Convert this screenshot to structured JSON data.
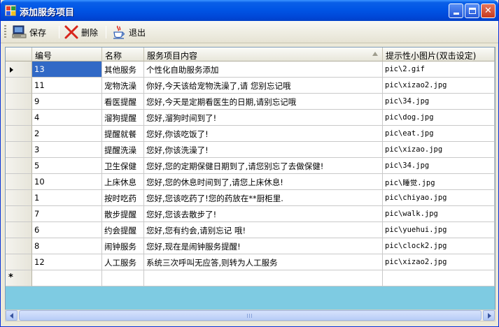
{
  "window": {
    "title": "添加服务项目"
  },
  "toolbar": {
    "save_label": "保存",
    "delete_label": "删除",
    "exit_label": "退出"
  },
  "grid": {
    "columns": [
      "编号",
      "名称",
      "服务项目内容",
      "提示性小图片(双击设定)"
    ],
    "rows": [
      [
        "13",
        "其他服务",
        "个性化自助服务添加",
        "pic\\2.gif"
      ],
      [
        "11",
        "宠物洗澡",
        "你好,今天该给宠物洗澡了,请  您别忘记哦",
        "pic\\xizao2.jpg"
      ],
      [
        "9",
        "看医提醒",
        "您好,今天是定期看医生的日期,请别忘记哦",
        "pic\\34.jpg"
      ],
      [
        "4",
        "溜狗提醒",
        "您好,溜狗时间到了!",
        "pic\\dog.jpg"
      ],
      [
        "2",
        "提醒就餐",
        "您好,你该吃饭了!",
        "pic\\eat.jpg"
      ],
      [
        "3",
        "提醒洗澡",
        "您好,你该洗澡了!",
        "pic\\xizao.jpg"
      ],
      [
        "5",
        "卫生保健",
        "您好,您的定期保健日期到了,请您别忘了去做保健!",
        "pic\\34.jpg"
      ],
      [
        "10",
        "上床休息",
        "您好,您的休息时间到了,请您上床休息!",
        "pic\\睡觉.jpg"
      ],
      [
        "1",
        "按时吃药",
        "您好,您该吃药了!您的药放在**厨柜里.",
        "pic\\chiyao.jpg"
      ],
      [
        "7",
        "散步提醒",
        "您好,您该去散步了!",
        "pic\\walk.jpg"
      ],
      [
        "6",
        "约会提醒",
        "您好,您有约会,请别忘记  哦!",
        "pic\\yuehui.jpg"
      ],
      [
        "8",
        "闹钟服务",
        "您好,现在是闹钟服务提醒!",
        "pic\\clock2.jpg"
      ],
      [
        "12",
        "人工服务",
        "系统三次呼叫无应答,则转为人工服务",
        "pic\\xizao2.jpg"
      ]
    ],
    "new_row_marker": "*"
  },
  "colors": {
    "title_bar": "#0055e5",
    "selection": "#3169c6",
    "grid_background": "#7ecbe2"
  }
}
